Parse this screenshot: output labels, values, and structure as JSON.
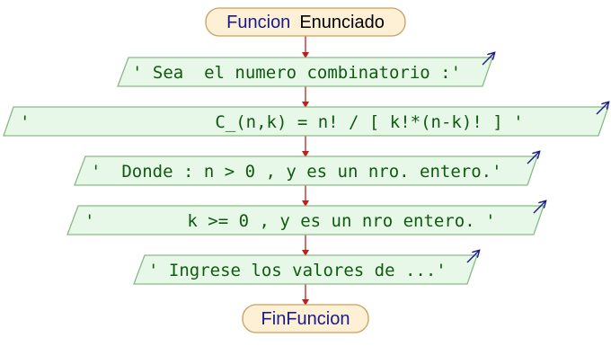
{
  "flowchart": {
    "start": {
      "prefix": "Funcion",
      "name": "Enunciado"
    },
    "steps": [
      {
        "text": "' Sea  el numero combinatorio :'"
      },
      {
        "text": "'                  C_(n,k) = n! / [ k!*(n-k)! ] '"
      },
      {
        "text": "'  Donde : n > 0 , y es un nro. entero.'"
      },
      {
        "text": "'         k >= 0 , y es un nro entero. '"
      },
      {
        "text": "' Ingrese los valores de ...'"
      }
    ],
    "end": {
      "label": "FinFuncion"
    }
  },
  "colors": {
    "terminal_fill": "#fdf0d5",
    "terminal_stroke": "#c7a062",
    "io_fill": "#e8f8e8",
    "io_stroke": "#86ba86",
    "arrow": "#c0201a",
    "keyword": "#1a1a8c",
    "text": "#0e5a0e",
    "output_mark": "#1a1a8c"
  }
}
